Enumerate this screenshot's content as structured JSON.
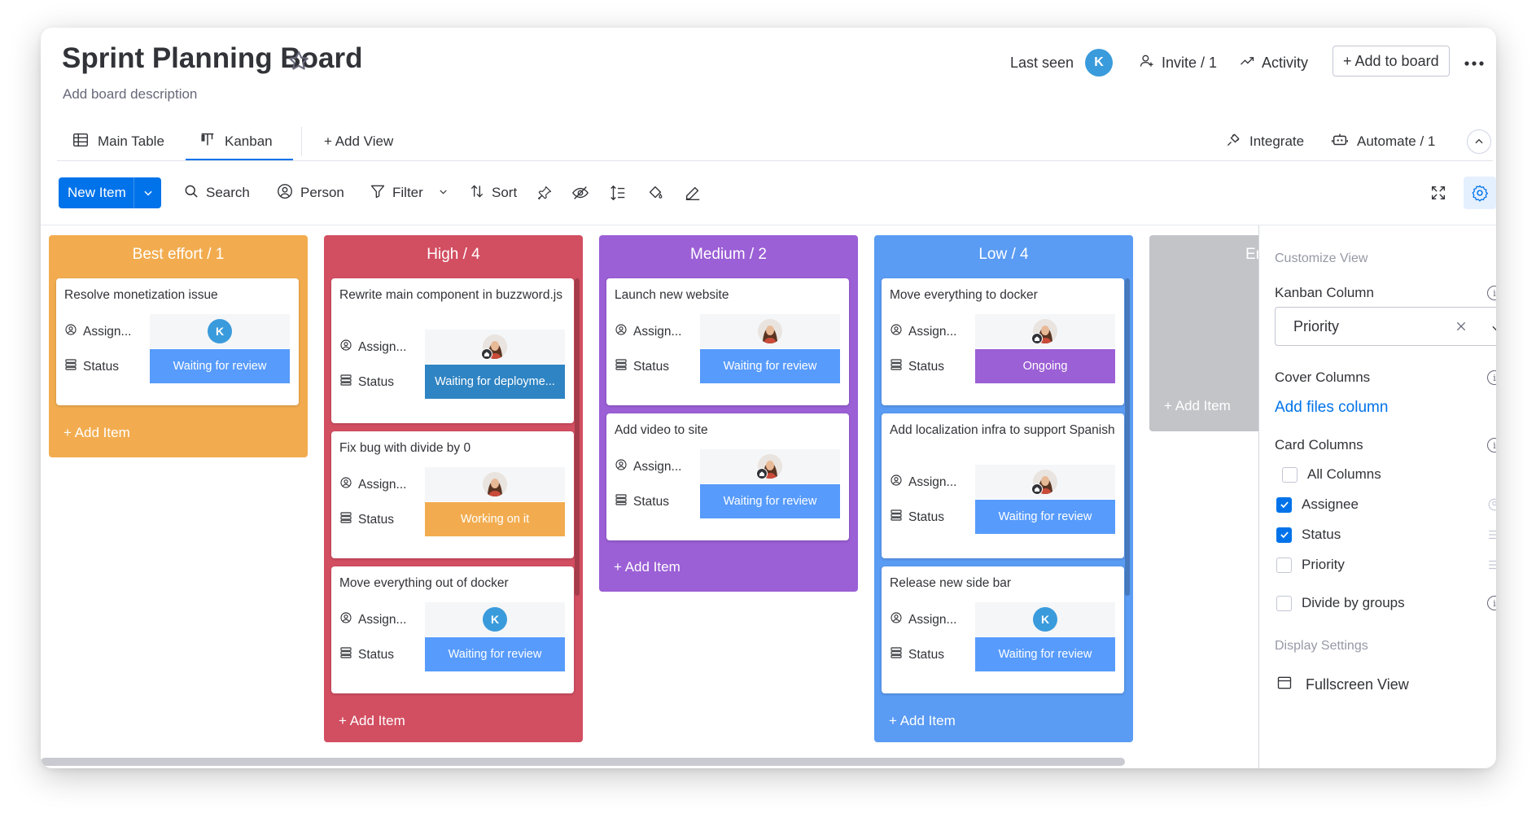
{
  "board": {
    "title": "Sprint Planning Board",
    "description": "Add board description"
  },
  "header": {
    "last_seen_label": "Last seen",
    "last_seen_avatar": "K",
    "invite_label": "Invite / 1",
    "activity_label": "Activity",
    "add_to_board_label": "+ Add to board"
  },
  "tabs": {
    "main_table": "Main Table",
    "kanban": "Kanban",
    "add_view": "+ Add View",
    "integrate": "Integrate",
    "automate": "Automate / 1"
  },
  "toolbar": {
    "new_item": "New Item",
    "search": "Search",
    "person": "Person",
    "filter": "Filter",
    "sort": "Sort"
  },
  "card_labels": {
    "assignee": "Assign...",
    "status": "Status"
  },
  "columns": [
    {
      "title": "Best effort / 1",
      "color": "#f2ac4f",
      "add_item": "+ Add Item",
      "cards": [
        {
          "title": "Resolve monetization issue",
          "assignee": "K",
          "status": "Waiting for review",
          "status_color": "#579bfc"
        }
      ]
    },
    {
      "title": "High / 4",
      "color": "#d24e61",
      "add_item": "+ Add Item",
      "cards": [
        {
          "title": "Rewrite main component in buzzword.js",
          "assignee": "photo-home",
          "status": "Waiting for deployme...",
          "status_color": "#2f84c3"
        },
        {
          "title": "Fix bug with divide by 0",
          "assignee": "photo",
          "status": "Working on it",
          "status_color": "#f2ac4f"
        },
        {
          "title": "Move everything out of docker",
          "assignee": "K",
          "status": "Waiting for review",
          "status_color": "#579bfc"
        }
      ]
    },
    {
      "title": "Medium / 2",
      "color": "#9b5fd6",
      "add_item": "+ Add Item",
      "cards": [
        {
          "title": "Launch new website",
          "assignee": "photo",
          "status": "Waiting for review",
          "status_color": "#579bfc"
        },
        {
          "title": "Add video to site",
          "assignee": "photo-home",
          "status": "Waiting for review",
          "status_color": "#579bfc"
        }
      ]
    },
    {
      "title": "Low / 4",
      "color": "#5a9bf3",
      "add_item": "+ Add Item",
      "cards": [
        {
          "title": "Move everything to docker",
          "assignee": "photo-home",
          "status": "Ongoing",
          "status_color": "#9b5fd6"
        },
        {
          "title": "Add localization infra to support Spanish",
          "assignee": "photo-home",
          "status": "Waiting for review",
          "status_color": "#579bfc"
        },
        {
          "title": "Release new side bar",
          "assignee": "K",
          "status": "Waiting for review",
          "status_color": "#579bfc"
        }
      ]
    },
    {
      "title": "Em",
      "color": "#c3c4c8",
      "add_item": "+ Add Item",
      "cards": []
    }
  ],
  "panel": {
    "customize_view": "Customize View",
    "kanban_column_label": "Kanban Column",
    "kanban_column_value": "Priority",
    "cover_columns_label": "Cover Columns",
    "add_files_column": "Add files column",
    "card_columns_label": "Card Columns",
    "options": [
      {
        "label": "All Columns",
        "checked": false
      },
      {
        "label": "Assignee",
        "checked": true
      },
      {
        "label": "Status",
        "checked": true
      },
      {
        "label": "Priority",
        "checked": false
      }
    ],
    "divide_by_groups": "Divide by groups",
    "display_settings": "Display Settings",
    "fullscreen_view": "Fullscreen View"
  },
  "colors": {
    "accent": "#0073ea",
    "link": "#0073ea"
  }
}
